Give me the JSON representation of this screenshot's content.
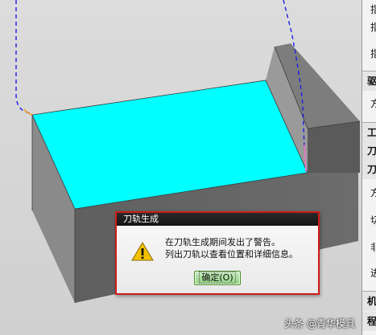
{
  "dialog": {
    "title": "刀轨生成",
    "message_line1": "在刀轨生成期间发出了警告。",
    "message_line2": "列出刀轨以查看位置和详细信息。",
    "ok_label": "确定(O)"
  },
  "side_panel": {
    "rows": [
      "指",
      "指",
      "指",
      "驱",
      "方",
      "工",
      "刀",
      "刀",
      "方",
      "切",
      "非",
      "进",
      "机",
      "程"
    ]
  },
  "watermark": "头条 @青华模具",
  "colors": {
    "part_top_face": "#00ffff",
    "toolpath": "#1e1ee6",
    "dialog_border": "#d01a1a",
    "dialog_titlebar": "#1a1a1a",
    "ok_button": "#a8e09a",
    "warning_icon": "#f2c200"
  },
  "icons": {
    "warning": "warning-icon"
  }
}
